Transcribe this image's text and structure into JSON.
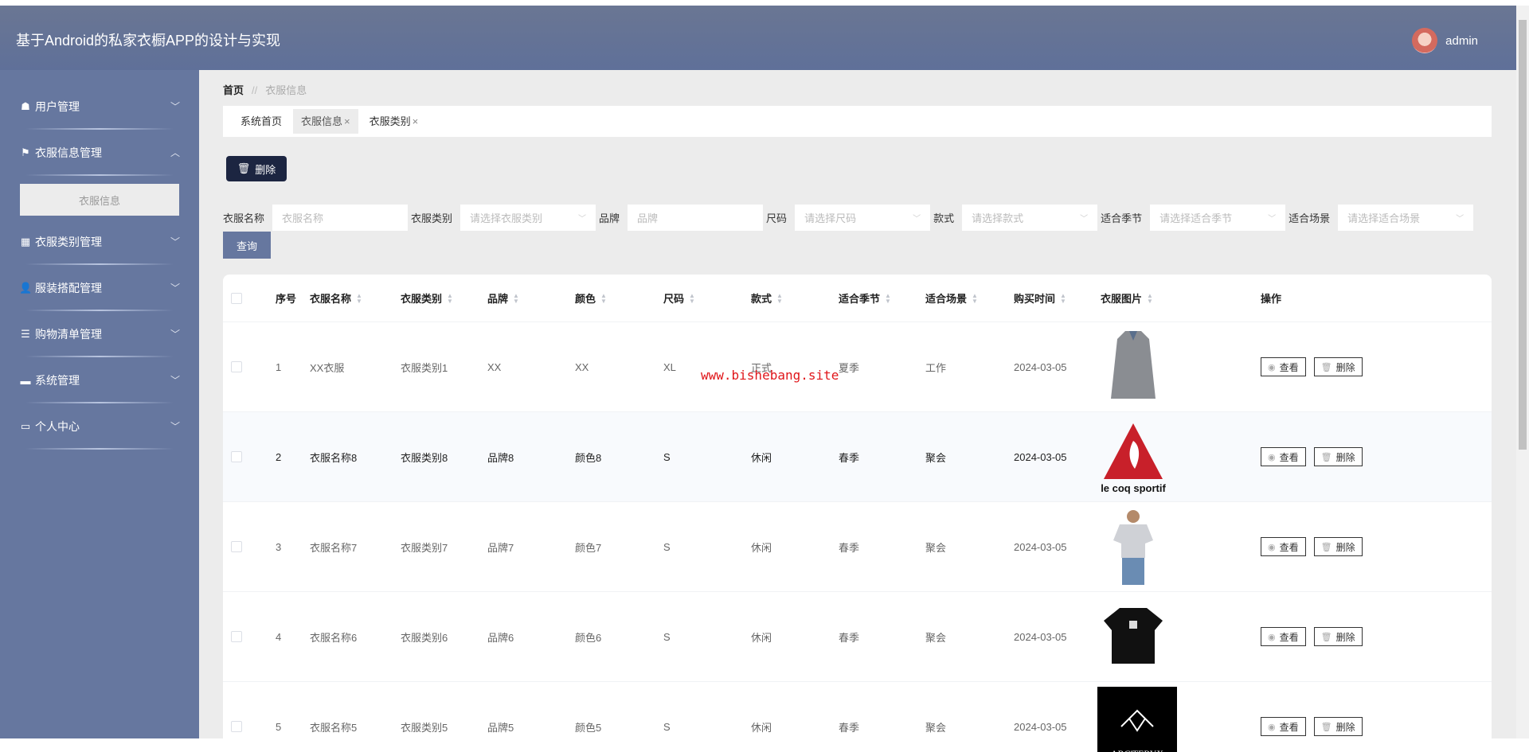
{
  "header": {
    "title": "基于Android的私家衣橱APP的设计与实现",
    "user": "admin"
  },
  "sidebar": {
    "items": [
      {
        "label": "用户管理",
        "icon": "home-user-icon",
        "expanded": false
      },
      {
        "label": "衣服信息管理",
        "icon": "flag-icon",
        "expanded": true,
        "children": [
          "衣服信息"
        ]
      },
      {
        "label": "衣服类别管理",
        "icon": "grid-icon",
        "expanded": false
      },
      {
        "label": "服装搭配管理",
        "icon": "user-icon",
        "expanded": false
      },
      {
        "label": "购物清单管理",
        "icon": "sliders-icon",
        "expanded": false
      },
      {
        "label": "系统管理",
        "icon": "monitor-icon",
        "expanded": false
      },
      {
        "label": "个人中心",
        "icon": "card-icon",
        "expanded": false
      }
    ]
  },
  "breadcrumb": {
    "home": "首页",
    "sep": "//",
    "current": "衣服信息"
  },
  "tabs": [
    {
      "label": "系统首页"
    },
    {
      "label": "衣服信息",
      "close": "×"
    },
    {
      "label": "衣服类别",
      "close": "×"
    }
  ],
  "toolbar": {
    "delete": "删除"
  },
  "filters": [
    {
      "label": "衣服名称",
      "placeholder": "衣服名称"
    },
    {
      "label": "衣服类别",
      "placeholder": "请选择衣服类别"
    },
    {
      "label": "品牌",
      "placeholder": "品牌"
    },
    {
      "label": "尺码",
      "placeholder": "请选择尺码"
    },
    {
      "label": "款式",
      "placeholder": "请选择款式"
    },
    {
      "label": "适合季节",
      "placeholder": "请选择适合季节"
    },
    {
      "label": "适合场景",
      "placeholder": "请选择适合场景"
    }
  ],
  "query_button": "查询",
  "table": {
    "headers": [
      "序号",
      "衣服名称",
      "衣服类别",
      "品牌",
      "颜色",
      "尺码",
      "款式",
      "适合季节",
      "适合场景",
      "购买时间",
      "衣服图片",
      "操作"
    ],
    "rows": [
      [
        "1",
        "XX衣服",
        "衣服类别1",
        "XX",
        "XX",
        "XL",
        "正式",
        "夏季",
        "工作",
        "2024-03-05"
      ],
      [
        "2",
        "衣服名称8",
        "衣服类别8",
        "品牌8",
        "颜色8",
        "S",
        "休闲",
        "春季",
        "聚会",
        "2024-03-05"
      ],
      [
        "3",
        "衣服名称7",
        "衣服类别7",
        "品牌7",
        "颜色7",
        "S",
        "休闲",
        "春季",
        "聚会",
        "2024-03-05"
      ],
      [
        "4",
        "衣服名称6",
        "衣服类别6",
        "品牌6",
        "颜色6",
        "S",
        "休闲",
        "春季",
        "聚会",
        "2024-03-05"
      ],
      [
        "5",
        "衣服名称5",
        "衣服类别5",
        "品牌5",
        "颜色5",
        "S",
        "休闲",
        "春季",
        "聚会",
        "2024-03-05"
      ]
    ],
    "images": [
      "gray-shirt",
      "le coq sportif",
      "tshirt-model",
      "black-tshirt",
      "ARC'TERYX"
    ],
    "view": "查看",
    "delete": "删除"
  },
  "watermark": "www.bishebang.site"
}
